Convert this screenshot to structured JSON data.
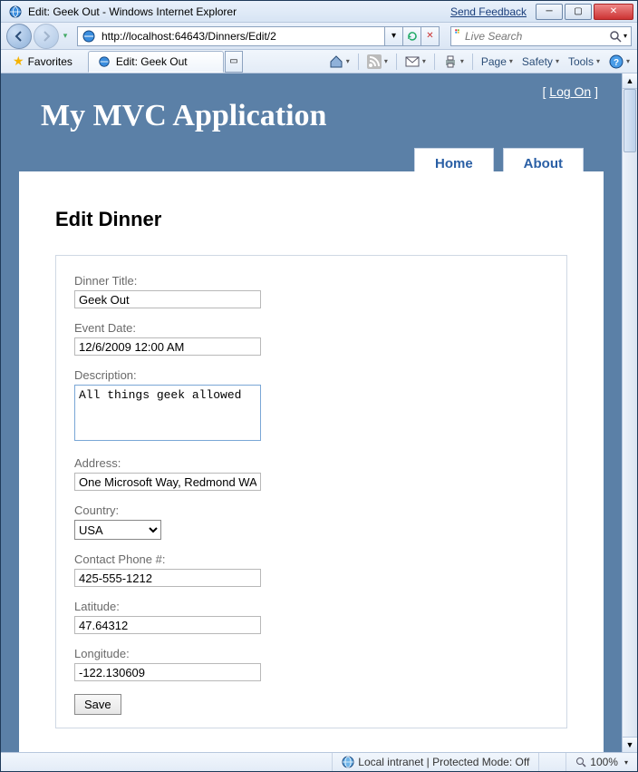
{
  "window": {
    "title": "Edit: Geek Out - Windows Internet Explorer",
    "feedback": "Send Feedback"
  },
  "nav": {
    "url": "http://localhost:64643/Dinners/Edit/2",
    "search_placeholder": "Live Search"
  },
  "toolbar": {
    "favorites": "Favorites",
    "tab_title": "Edit: Geek Out",
    "page": "Page",
    "safety": "Safety",
    "tools": "Tools"
  },
  "site": {
    "logon_prefix": "[ ",
    "logon": "Log On",
    "logon_suffix": " ]",
    "title": "My MVC Application",
    "nav_home": "Home",
    "nav_about": "About"
  },
  "page": {
    "heading": "Edit Dinner"
  },
  "form": {
    "title_label": "Dinner Title:",
    "title_value": "Geek Out",
    "date_label": "Event Date:",
    "date_value": "12/6/2009 12:00 AM",
    "desc_label": "Description:",
    "desc_value": "All things geek allowed",
    "address_label": "Address:",
    "address_value": "One Microsoft Way, Redmond WA",
    "country_label": "Country:",
    "country_value": "USA",
    "phone_label": "Contact Phone #:",
    "phone_value": "425-555-1212",
    "lat_label": "Latitude:",
    "lat_value": "47.64312",
    "lon_label": "Longitude:",
    "lon_value": "-122.130609",
    "save": "Save"
  },
  "status": {
    "zone": "Local intranet | Protected Mode: Off",
    "zoom": "100%"
  }
}
